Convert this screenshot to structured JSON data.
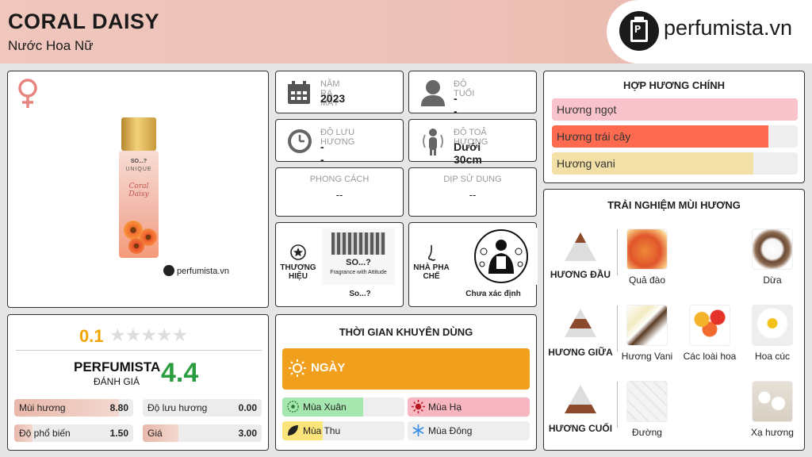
{
  "header": {
    "title": "CORAL DAISY",
    "subtitle": "Nước Hoa Nữ",
    "logo_text": "perfumista.vn"
  },
  "product": {
    "watermark": "perfumista.vn",
    "gender": "female-symbol-icon",
    "bottle_brand": "SO...?",
    "bottle_line": "UNIQUE",
    "bottle_name": "Coral Daisy"
  },
  "info": {
    "launch_year": {
      "label": "NĂM RA MẮT",
      "value": "2023"
    },
    "age": {
      "label": "ĐỘ TUỔI",
      "value": "--"
    },
    "longevity": {
      "label": "ĐỘ LƯU HƯƠNG",
      "value": "--"
    },
    "sillage": {
      "label": "ĐỘ TOẢ HƯƠNG",
      "value": "Dưới 30cm"
    },
    "style": {
      "label": "PHONG CÁCH",
      "value": "--"
    },
    "occasion": {
      "label": "DỊP SỬ DỤNG",
      "value": "--"
    }
  },
  "brand": {
    "label_line1": "THƯƠNG",
    "label_line2": "HIỆU",
    "name": "So...?",
    "logo_text": "SO...?",
    "logo_tagline": "Fragrance with Attitude"
  },
  "perfumer": {
    "label_line1": "NHÀ PHA",
    "label_line2": "CHẾ",
    "name": "Chưa xác định"
  },
  "rating": {
    "user_score": "0.1",
    "stars": 5,
    "perfumista_label": "PERFUMISTA",
    "perfumista_sub": "ĐÁNH GIÁ",
    "perfumista_score": "4.4",
    "metrics": [
      {
        "label": "Mùi hương",
        "value": "8.80",
        "fraction": 0.88
      },
      {
        "label": "Độ lưu hương",
        "value": "0.00",
        "fraction": 0.0
      },
      {
        "label": "Độ phổ biến",
        "value": "1.50",
        "fraction": 0.15
      },
      {
        "label": "Giá",
        "value": "3.00",
        "fraction": 0.3
      }
    ]
  },
  "accords": {
    "title": "HỢP HƯƠNG CHÍNH",
    "items": [
      {
        "label": "Hương ngọt",
        "fraction": 1.0,
        "color": "#f9c3cb"
      },
      {
        "label": "Hương trái cây",
        "fraction": 0.88,
        "color": "#fe6a4f"
      },
      {
        "label": "Hương vani",
        "fraction": 0.82,
        "color": "#f3e0a6"
      }
    ]
  },
  "usage": {
    "title": "THỜI GIAN KHUYÊN DÙNG",
    "day_label": "NGÀY",
    "seasons": [
      {
        "label": "Mùa Xuân",
        "fraction": 0.66,
        "color": "#a6e7b0"
      },
      {
        "label": "Mùa Hạ",
        "fraction": 1.0,
        "color": "#f7b6c0"
      },
      {
        "label": "Mùa Thu",
        "fraction": 0.33,
        "color": "#fbe57a"
      },
      {
        "label": "Mùa Đông",
        "fraction": 0.0,
        "color": "#d7ecfb"
      }
    ]
  },
  "notes": {
    "title": "TRẢI NGHIỆM MÙI HƯƠNG",
    "top": {
      "label": "HƯƠNG ĐẦU",
      "items": [
        "Quả đào",
        "Dừa"
      ]
    },
    "middle": {
      "label": "HƯƠNG GIỮA",
      "items": [
        "Hương Vani",
        "Các loài hoa",
        "Hoa cúc"
      ]
    },
    "base": {
      "label": "HƯƠNG CUỐI",
      "items": [
        "Đường",
        "Xạ hương"
      ]
    }
  }
}
